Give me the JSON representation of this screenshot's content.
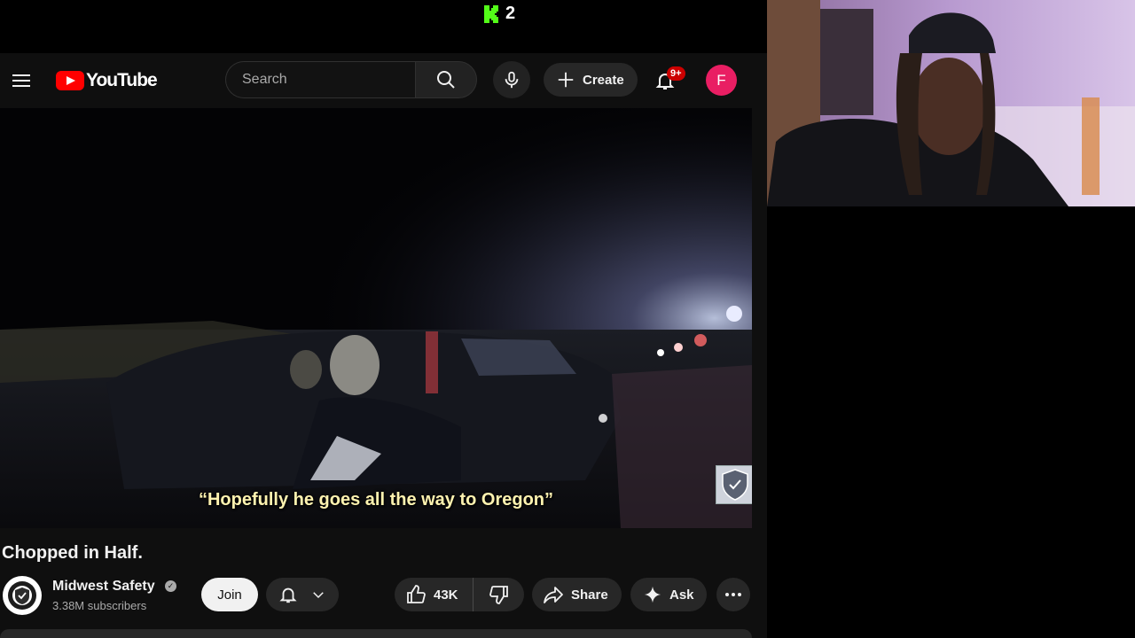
{
  "overlay": {
    "kick_count": "2",
    "kick_color": "#53fc18"
  },
  "youtube": {
    "logo_text": "YouTube",
    "search": {
      "placeholder": "Search",
      "value": ""
    },
    "create_label": "Create",
    "notifications_badge": "9+",
    "avatar_initial": "F",
    "avatar_color": "#e91e63",
    "brand_color": "#ff0000"
  },
  "video": {
    "caption": "“Hopefully he goes all the way to Oregon”",
    "title": "Chopped in Half.",
    "channel": {
      "name": "Midwest Safety",
      "subscribers": "3.38M subscribers",
      "verified": true
    },
    "actions": {
      "join_label": "Join",
      "like_count": "43K",
      "share_label": "Share",
      "ask_label": "Ask"
    }
  },
  "icons": [
    "menu-icon",
    "youtube-logo-icon",
    "search-icon",
    "mic-icon",
    "plus-icon",
    "bell-icon",
    "chevron-down-icon",
    "thumbs-up-icon",
    "thumbs-down-icon",
    "share-icon",
    "sparkle-icon",
    "more-horizontal-icon",
    "verified-icon",
    "kick-logo-icon"
  ]
}
